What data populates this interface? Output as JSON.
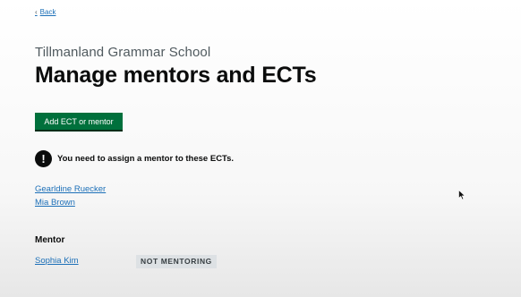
{
  "nav": {
    "back_label": "Back",
    "back_chevron": "‹"
  },
  "header": {
    "caption": "Tillmanland Grammar School",
    "title": "Manage mentors and ECTs"
  },
  "actions": {
    "add_label": "Add ECT or mentor"
  },
  "warning": {
    "icon": "exclamation-icon",
    "icon_glyph": "!",
    "text": "You need to assign a mentor to these ECTs."
  },
  "ects": [
    {
      "name": "Gearldine Ruecker"
    },
    {
      "name": "Mia Brown"
    }
  ],
  "mentors": {
    "heading": "Mentor",
    "items": [
      {
        "name": "Sophia Kim",
        "status": "NOT MENTORING"
      }
    ]
  },
  "colors": {
    "link": "#1d70b8",
    "button": "#00703c",
    "text": "#0b0c0c",
    "secondary_text": "#505a5f",
    "tag_background": "#dde1e4"
  }
}
